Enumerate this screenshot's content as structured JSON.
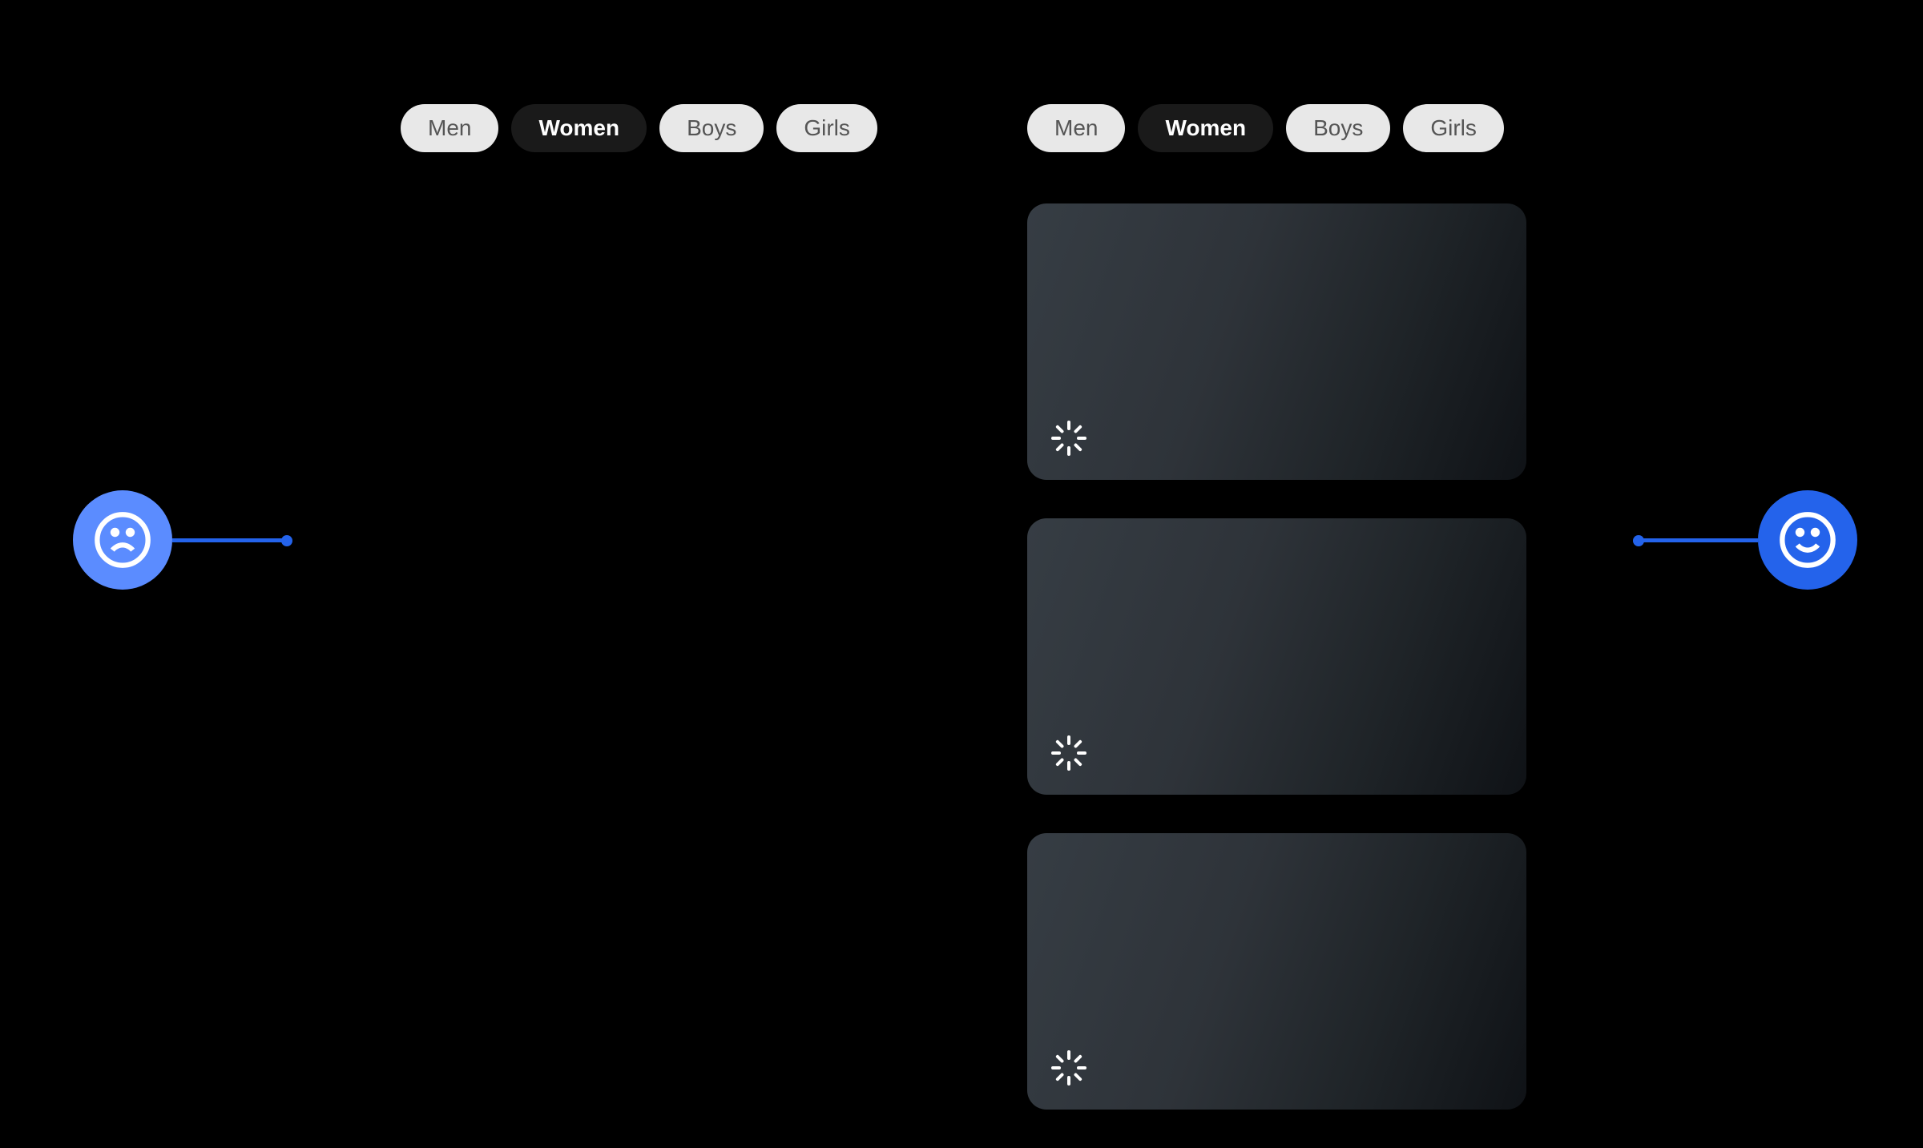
{
  "leftPanel": {
    "tabs": [
      {
        "label": "Men",
        "active": false
      },
      {
        "label": "Women",
        "active": true
      },
      {
        "label": "Boys",
        "active": false
      },
      {
        "label": "Girls",
        "active": false
      }
    ]
  },
  "rightPanel": {
    "tabs": [
      {
        "label": "Men",
        "active": false
      },
      {
        "label": "Women",
        "active": true
      },
      {
        "label": "Boys",
        "active": false
      },
      {
        "label": "Girls",
        "active": false
      }
    ],
    "skeletonCards": 3
  },
  "indicators": {
    "leftFace": "sad",
    "rightFace": "happy"
  }
}
